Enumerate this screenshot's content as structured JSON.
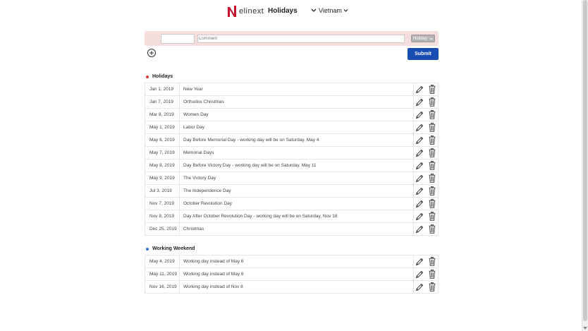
{
  "header": {
    "brand": "elinext",
    "title": "Holidays",
    "country": "Vietnam"
  },
  "form": {
    "date_value": "",
    "comment_placeholder": "Comment",
    "type_value": "Holiday",
    "submit_label": "Submit"
  },
  "colors": {
    "holiday_dot": "#e23b3b",
    "working_dot": "#3b6fe2",
    "submit_bg": "#1a4db3"
  },
  "sections": [
    {
      "title": "Holidays",
      "rows": [
        {
          "date": "Jan 1, 2019",
          "name": "New Year"
        },
        {
          "date": "Jan 7, 2019",
          "name": "Orthodox Christmas"
        },
        {
          "date": "Mar 8, 2019",
          "name": "Women Day"
        },
        {
          "date": "May 1, 2019",
          "name": "Labor Day"
        },
        {
          "date": "May 6, 2019",
          "name": "Day Before Memorial Day - working day will be on Saturday, May 4"
        },
        {
          "date": "May 7, 2019",
          "name": "Memorial Days"
        },
        {
          "date": "May 8, 2019",
          "name": "Day Before Victory Day - working day will be on Saturday, May 11"
        },
        {
          "date": "May 9, 2019",
          "name": "The Victory Day"
        },
        {
          "date": "Jul 3, 2019",
          "name": "The Independence Day"
        },
        {
          "date": "Nov 7, 2019",
          "name": "October Revolution Day"
        },
        {
          "date": "Nov 8, 2019",
          "name": "Day After October Revolution Day - working day will be on Saturday, Nov 16"
        },
        {
          "date": "Dec 25, 2019",
          "name": "Christmas"
        }
      ]
    },
    {
      "title": "Working Weekend",
      "rows": [
        {
          "date": "May 4, 2019",
          "name": "Working day instead of May 6"
        },
        {
          "date": "May 11, 2019",
          "name": "Working day instead of May 8"
        },
        {
          "date": "Nov 16, 2019",
          "name": "Working day instead of Nov 8"
        }
      ]
    }
  ]
}
